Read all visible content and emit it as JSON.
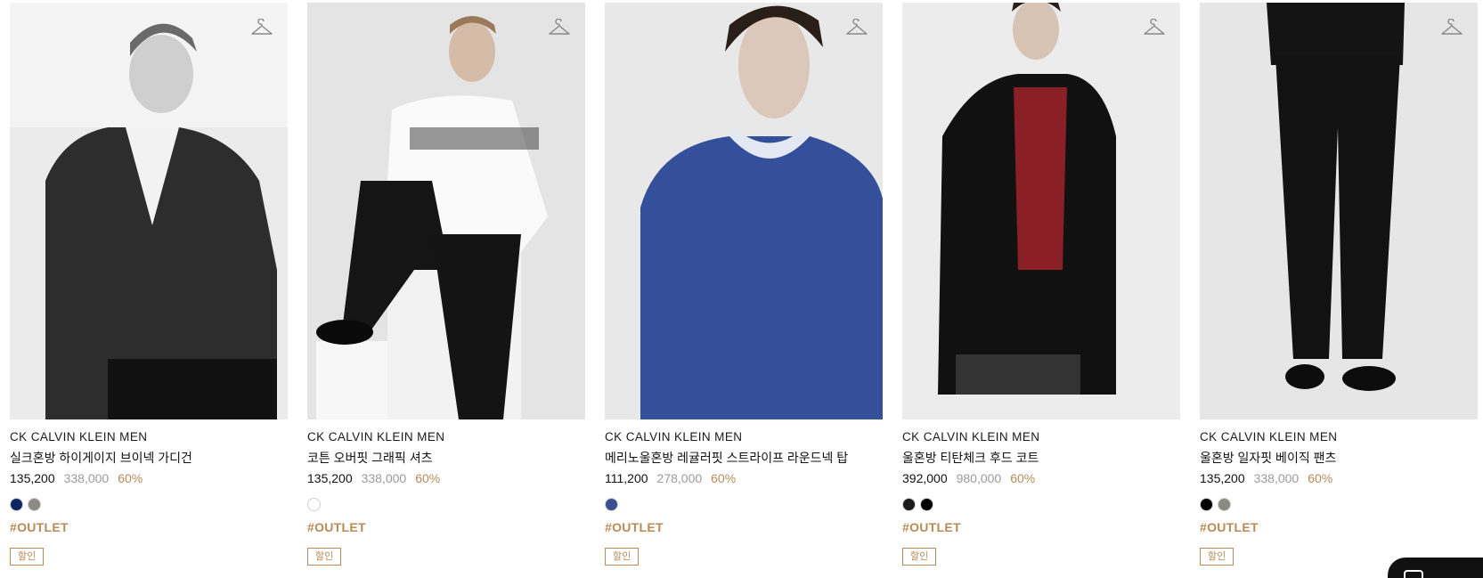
{
  "products": [
    {
      "brand": "CK CALVIN KLEIN MEN",
      "name": "실크혼방 하이게이지 브이넥 가디건",
      "price": "135,200",
      "original_price": "338,000",
      "discount": "60%",
      "colors": [
        "#0d2660",
        "#8c8a85"
      ],
      "tag": "#OUTLET",
      "badge": "할인",
      "icon": "hanger-icon",
      "image": "man-in-dark-cardigan"
    },
    {
      "brand": "CK CALVIN KLEIN MEN",
      "name": "코튼 오버핏 그래픽 셔츠",
      "price": "135,200",
      "original_price": "338,000",
      "discount": "60%",
      "colors": [
        "#ffffff"
      ],
      "tag": "#OUTLET",
      "badge": "할인",
      "icon": "hanger-icon",
      "image": "man-in-white-graphic-shirt"
    },
    {
      "brand": "CK CALVIN KLEIN MEN",
      "name": "메리노울혼방 레귤러핏 스트라이프 라운드넥 탑",
      "price": "111,200",
      "original_price": "278,000",
      "discount": "60%",
      "colors": [
        "#3a4f8f"
      ],
      "tag": "#OUTLET",
      "badge": "할인",
      "icon": "hanger-icon",
      "image": "man-in-blue-sweater"
    },
    {
      "brand": "CK CALVIN KLEIN MEN",
      "name": "울혼방 티탄체크 후드 코트",
      "price": "392,000",
      "original_price": "980,000",
      "discount": "60%",
      "colors": [
        "#1b1b1b",
        "#000000"
      ],
      "tag": "#OUTLET",
      "badge": "할인",
      "icon": "hanger-icon",
      "image": "man-in-black-hooded-coat"
    },
    {
      "brand": "CK CALVIN KLEIN MEN",
      "name": "울혼방 일자핏 베이직 팬츠",
      "price": "135,200",
      "original_price": "338,000",
      "discount": "60%",
      "colors": [
        "#000000",
        "#8a8a80"
      ],
      "tag": "#OUTLET",
      "badge": "할인",
      "icon": "hanger-icon",
      "image": "black-straight-pants"
    }
  ],
  "chat_button": {
    "icon": "chat-icon"
  }
}
